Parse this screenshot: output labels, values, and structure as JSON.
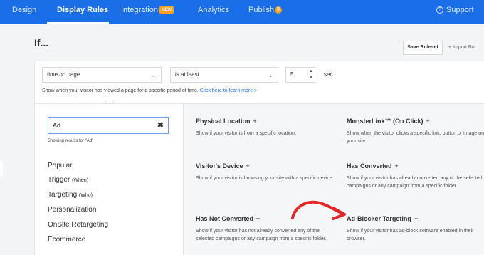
{
  "nav": {
    "items": [
      "Design",
      "Display Rules",
      "Integrations",
      "Analytics",
      "Publish"
    ],
    "integrations_badge": "NEW",
    "publish_badge": "0",
    "support": "Support"
  },
  "header": {
    "title": "If...",
    "save_label": "Save Ruleset",
    "import_label": "+ Import Rul"
  },
  "rule": {
    "field": "time on page",
    "operator": "is at least",
    "value": "5",
    "unit": "sec.",
    "help_text": "Show when your visitor has viewed a page for a specific period of time.",
    "help_link": "Click here to learn more »"
  },
  "search": {
    "value": "Ad",
    "results_text": "Showing results for \"Ad\""
  },
  "categories": [
    {
      "label": "Popular",
      "sub": ""
    },
    {
      "label": "Trigger",
      "sub": "(When)"
    },
    {
      "label": "Targeting",
      "sub": "(Who)"
    },
    {
      "label": "Personalization",
      "sub": ""
    },
    {
      "label": "OnSite Retargeting",
      "sub": ""
    },
    {
      "label": "Ecommerce",
      "sub": ""
    }
  ],
  "rules": [
    {
      "title": "Physical Location",
      "desc": "Show if your visitor is from a specific location."
    },
    {
      "title": "MonsterLink™ (On Click)",
      "desc": "Show when the visitor clicks a specific link, button or image on your site."
    },
    {
      "title": "Visitor's Device",
      "desc": "Show if your visitor is browsing your site with a specific device."
    },
    {
      "title": "Has Converted",
      "desc": "Show if your visitor has already converted any of the selected campaigns or any campaign from a specific folder."
    },
    {
      "title": "Has Not Converted",
      "desc": "Show if your visitor has not already converted any of the selected campaigns or any campaign from a specific folder."
    },
    {
      "title": "Ad-Blocker Targeting",
      "desc": "Show if your visitor has ad-block software enabled in their browser."
    }
  ],
  "icons": {
    "clear": "close-icon",
    "support": "help-circle-icon",
    "chevron": "chevron-down-icon",
    "annotation": "red-arrow-icon"
  },
  "colors": {
    "nav": "#1a6ee8",
    "badge": "#ff9f1c",
    "arrow": "#e32626"
  }
}
